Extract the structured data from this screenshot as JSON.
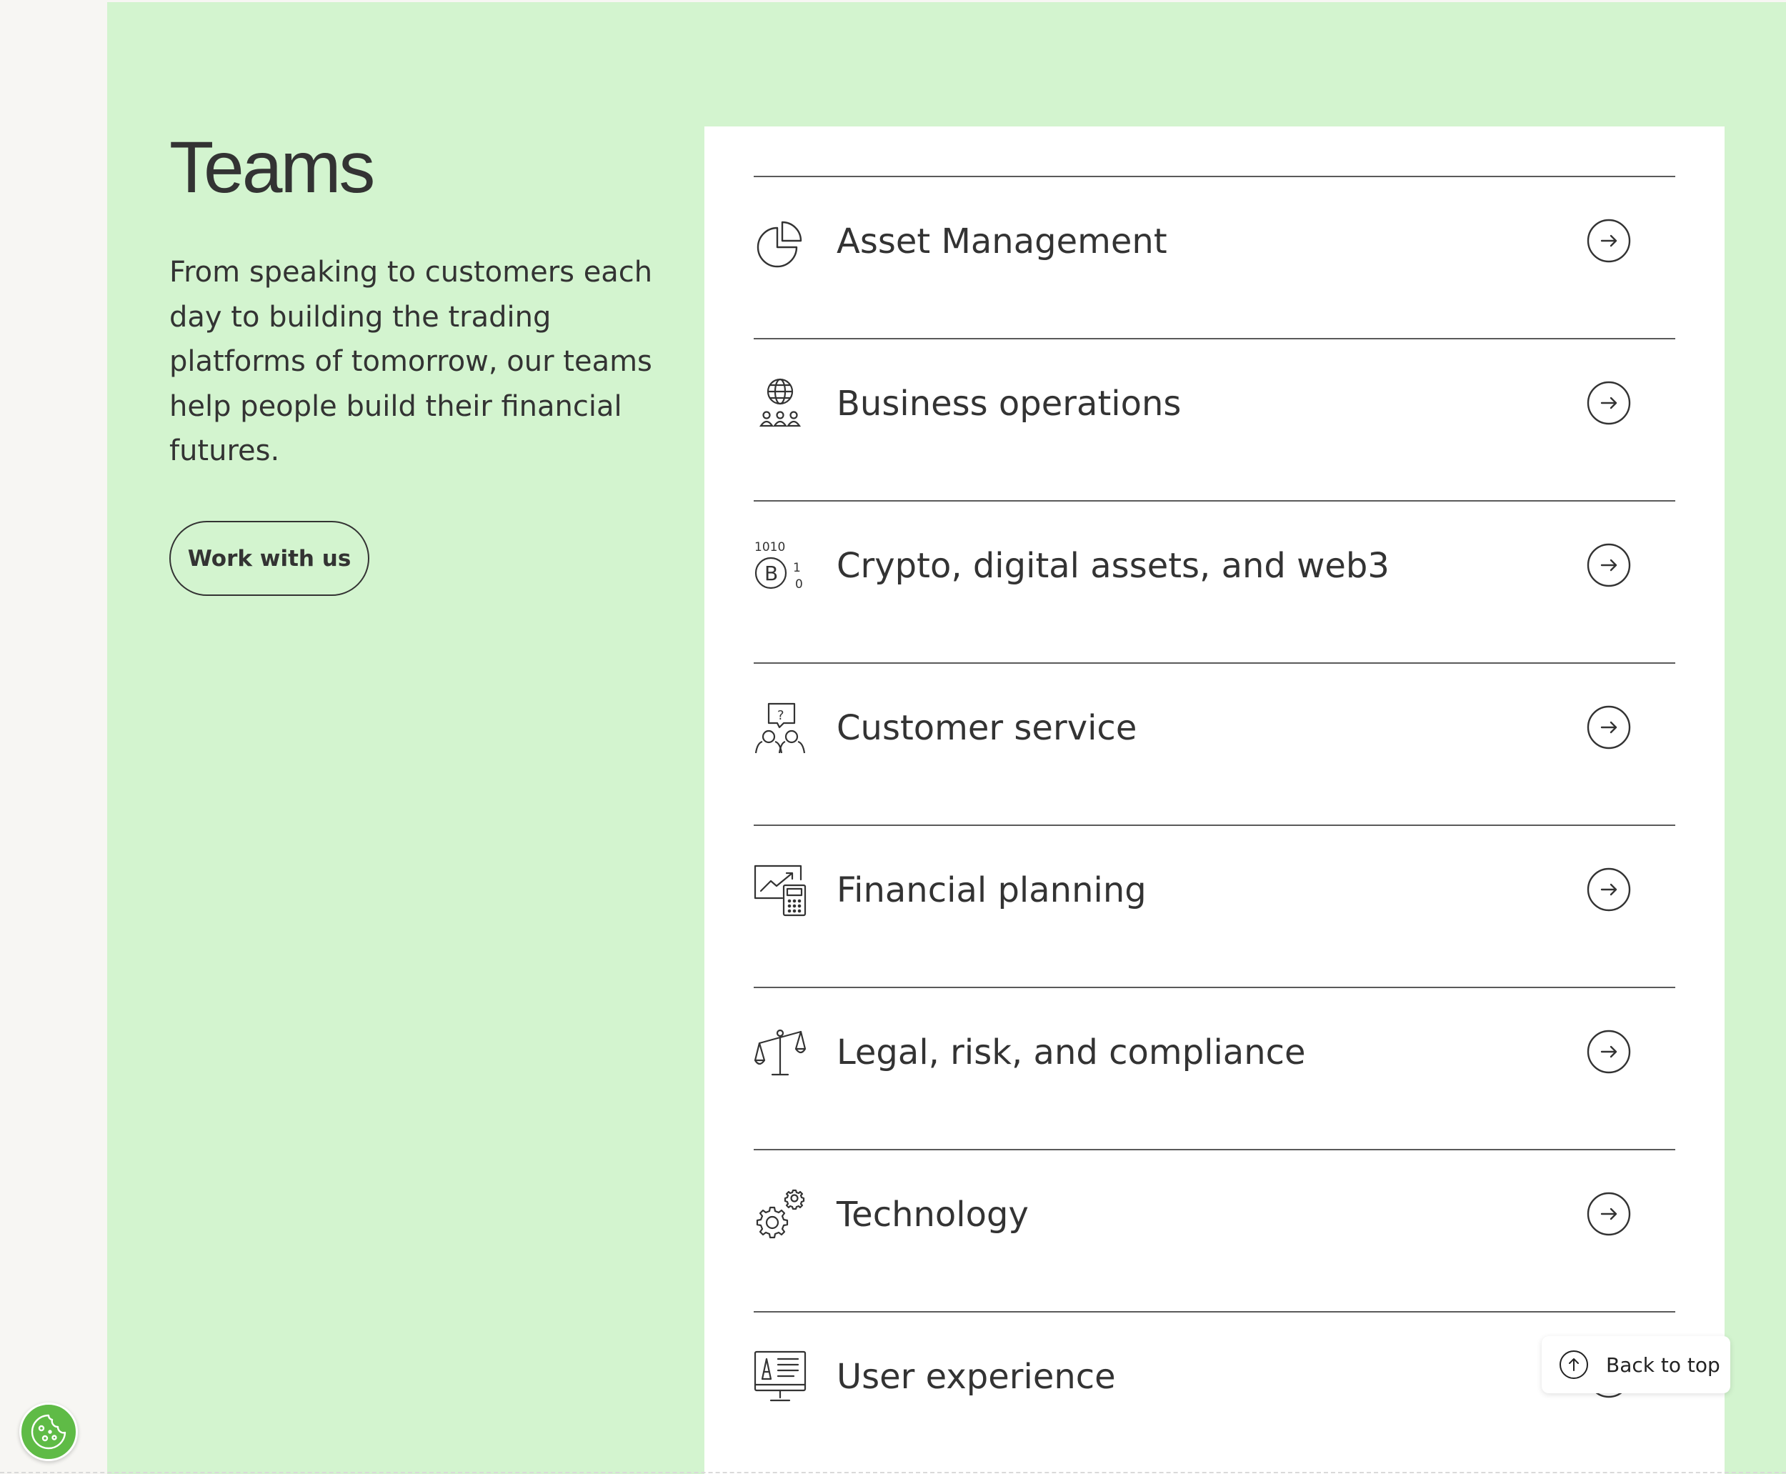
{
  "section": {
    "title": "Teams",
    "description": "From speaking to customers each day to building the trading platforms of tomorrow, our teams help people build their financial futures.",
    "cta_label": "Work with us"
  },
  "teams": [
    {
      "label": "Asset Management",
      "icon": "pie-chart-icon"
    },
    {
      "label": "Business operations",
      "icon": "globe-people-icon"
    },
    {
      "label": "Crypto, digital assets, and web3",
      "icon": "bitcoin-binary-icon"
    },
    {
      "label": "Customer service",
      "icon": "support-question-icon"
    },
    {
      "label": "Financial planning",
      "icon": "chart-calculator-icon"
    },
    {
      "label": "Legal, risk, and compliance",
      "icon": "scales-icon"
    },
    {
      "label": "Technology",
      "icon": "gears-icon"
    },
    {
      "label": "User experience",
      "icon": "design-monitor-icon"
    }
  ],
  "back_to_top": {
    "label": "Back to top"
  },
  "colors": {
    "panel_background": "#d3f4cf",
    "card_background": "#ffffff",
    "text": "#333333",
    "cookie_button": "#5fbb46",
    "page_background": "#f7f6f3"
  }
}
